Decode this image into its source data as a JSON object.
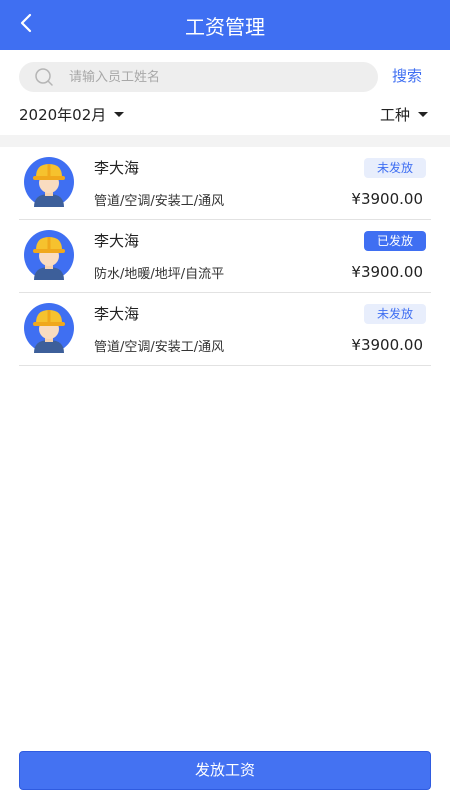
{
  "header": {
    "title": "工资管理",
    "back_icon": "chevron-left-icon"
  },
  "search": {
    "placeholder": "请输入员工姓名",
    "value": "",
    "button_label": "搜索",
    "icon": "search-icon"
  },
  "filters": {
    "month_label": "2020年02月",
    "type_label": "工种"
  },
  "colors": {
    "primary": "#3f6ff2",
    "badge_unpaid_bg": "#e8eefc",
    "divider": "#f3f3f3"
  },
  "workers": [
    {
      "name": "李大海",
      "trades": "管道/空调/安装工/通风",
      "status": "未发放",
      "status_key": "unpaid",
      "amount": "¥3900.00"
    },
    {
      "name": "李大海",
      "trades": "防水/地暖/地坪/自流平",
      "status": "已发放",
      "status_key": "paid",
      "amount": "¥3900.00"
    },
    {
      "name": "李大海",
      "trades": "管道/空调/安装工/通风",
      "status": "未发放",
      "status_key": "unpaid",
      "amount": "¥3900.00"
    }
  ],
  "footer": {
    "pay_button_label": "发放工资"
  }
}
